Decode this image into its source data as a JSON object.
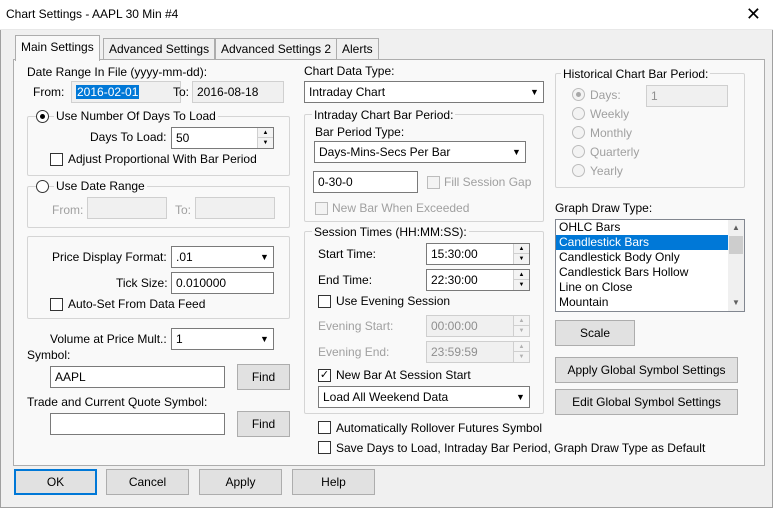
{
  "window": {
    "title": "Chart Settings - AAPL  30 Min   #4",
    "close_glyph": "✕"
  },
  "tabs": [
    {
      "label": "Main Settings",
      "active": true
    },
    {
      "label": "Advanced Settings",
      "active": false
    },
    {
      "label": "Advanced Settings 2",
      "active": false
    },
    {
      "label": "Alerts",
      "active": false
    }
  ],
  "date_range": {
    "label": "Date Range In File (yyyy-mm-dd):",
    "from_label": "From:",
    "from_value": "2016-02-01",
    "to_label": "To:",
    "to_value": "2016-08-18"
  },
  "days_group": {
    "radio_label": "Use Number Of Days To Load",
    "days_label": "Days To Load:",
    "days_value": "50",
    "adjust_label": "Adjust Proportional With Bar Period"
  },
  "date_range_group": {
    "radio_label": "Use Date Range",
    "from_label": "From:",
    "to_label": "To:"
  },
  "price_group": {
    "format_label": "Price Display Format:",
    "format_value": ".01",
    "tick_label": "Tick Size:",
    "tick_value": "0.010000",
    "autoset_label": "Auto-Set From Data Feed"
  },
  "volume": {
    "label": "Volume at Price Mult.:",
    "value": "1"
  },
  "symbol": {
    "label": "Symbol:",
    "value": "AAPL",
    "find_label": "Find"
  },
  "trade_symbol": {
    "label": "Trade and Current Quote Symbol:",
    "value": "",
    "find_label": "Find"
  },
  "chart_data_type": {
    "label": "Chart Data Type:",
    "value": "Intraday Chart"
  },
  "intraday_period": {
    "group_label": "Intraday Chart Bar Period:",
    "type_label": "Bar Period Type:",
    "type_value": "Days-Mins-Secs Per Bar",
    "period_value": "0-30-0",
    "fill_gap_label": "Fill Session Gap",
    "new_bar_exceeded_label": "New Bar When Exceeded"
  },
  "session": {
    "group_label": "Session Times (HH:MM:SS):",
    "start_label": "Start Time:",
    "start_value": "15:30:00",
    "end_label": "End Time:",
    "end_value": "22:30:00",
    "evening_label": "Use Evening Session",
    "evening_start_label": "Evening Start:",
    "evening_start_value": "00:00:00",
    "evening_end_label": "Evening End:",
    "evening_end_value": "23:59:59",
    "new_bar_label": "New Bar At Session Start",
    "weekend_value": "Load All Weekend Data"
  },
  "historical": {
    "group_label": "Historical Chart Bar Period:",
    "days_label": "Days:",
    "days_value": "1",
    "weekly": "Weekly",
    "monthly": "Monthly",
    "quarterly": "Quarterly",
    "yearly": "Yearly"
  },
  "graph_draw": {
    "label": "Graph Draw Type:",
    "items": [
      "OHLC Bars",
      "Candlestick Bars",
      "Candlestick Body Only",
      "Candlestick Bars Hollow",
      "Line on Close",
      "Mountain"
    ],
    "selected": "Candlestick Bars"
  },
  "scale_label": "Scale",
  "apply_global_label": "Apply Global Symbol Settings",
  "edit_global_label": "Edit Global Symbol Settings",
  "rollover_label": "Automatically Rollover Futures Symbol",
  "save_default_label": "Save Days to Load, Intraday Bar Period, Graph Draw Type as Default",
  "buttons": {
    "ok": "OK",
    "cancel": "Cancel",
    "apply": "Apply",
    "help": "Help"
  }
}
